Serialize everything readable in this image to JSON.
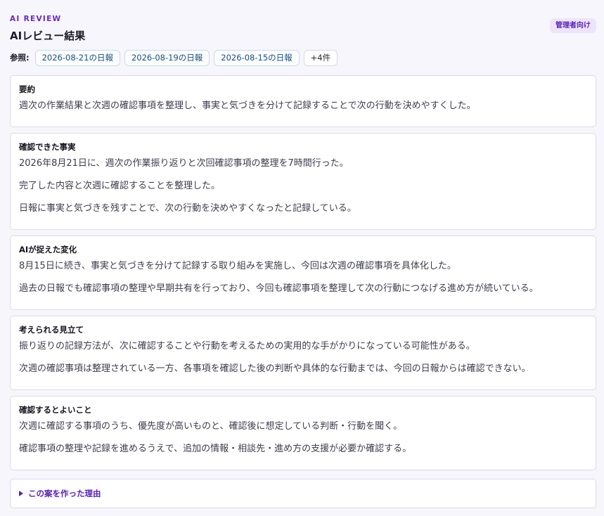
{
  "header": {
    "eyebrow": "AI REVIEW",
    "title": "AIレビュー結果",
    "badge": "管理者向け"
  },
  "refs": {
    "label": "参照:",
    "items": [
      "2026-08-21の日報",
      "2026-08-19の日報",
      "2026-08-15の日報"
    ],
    "more": "+4件"
  },
  "sections": [
    {
      "title": "要約",
      "lines": [
        "週次の作業結果と次週の確認事項を整理し、事実と気づきを分けて記録することで次の行動を決めやすくした。"
      ]
    },
    {
      "title": "確認できた事実",
      "lines": [
        "2026年8月21日に、週次の作業振り返りと次回確認事項の整理を7時間行った。",
        "完了した内容と次週に確認することを整理した。",
        "日報に事実と気づきを残すことで、次の行動を決めやすくなったと記録している。"
      ]
    },
    {
      "title": "AIが捉えた変化",
      "lines": [
        "8月15日に続き、事実と気づきを分けて記録する取り組みを実施し、今回は次週の確認事項を具体化した。",
        "過去の日報でも確認事項の整理や早期共有を行っており、今回も確認事項を整理して次の行動につなげる進め方が続いている。"
      ]
    },
    {
      "title": "考えられる見立て",
      "lines": [
        "振り返りの記録方法が、次に確認することや行動を考えるための実用的な手がかりになっている可能性がある。",
        "次週の確認事項は整理されている一方、各事項を確認した後の判断や具体的な行動までは、今回の日報からは確認できない。"
      ]
    },
    {
      "title": "確認するとよいこと",
      "lines": [
        "次週に確認する事項のうち、優先度が高いものと、確認後に想定している判断・行動を聞く。",
        "確認事項の整理や記録を進めるうえで、追加の情報・相談先・進め方の支援が必要か確認する。"
      ]
    }
  ],
  "reason": {
    "label": "この案を作った理由"
  }
}
